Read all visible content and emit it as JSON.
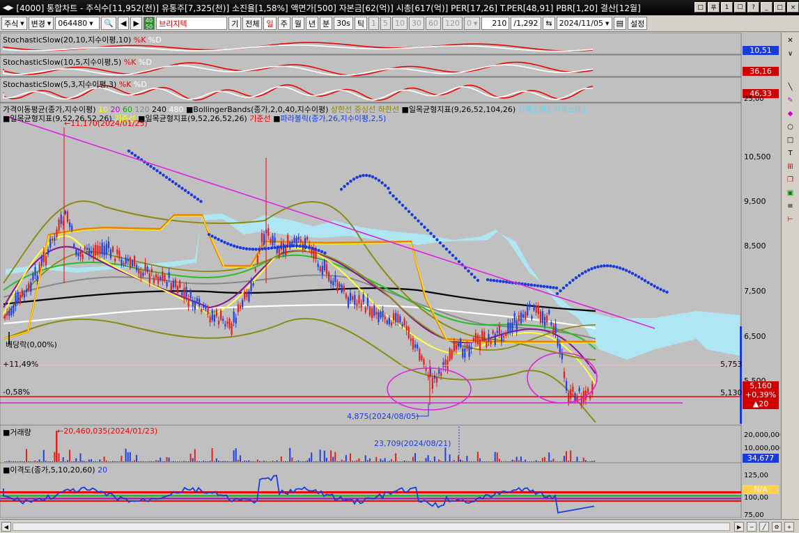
{
  "window": {
    "title": "[4000] 통합차트 - 주식수[11,952(천)] 유통주[7,325(천)] 소진율[1,58%] 액면가[500] 자본금[62(억)] 시총[617(억)] PER[17,26] T.PER[48,91] PBR[1,20] 결산[12월]",
    "nav_glyph": "◀▶",
    "buttons": [
      "□",
      "푸",
      "1",
      "☐",
      "?",
      "_",
      "□",
      "×"
    ]
  },
  "toolbar": {
    "market": "주식",
    "mode": "변경",
    "code": "064480",
    "stock_name": "브리지텍",
    "period_buttons": [
      "기",
      "전체",
      "일",
      "주",
      "월",
      "년",
      "분",
      "30s",
      "틱"
    ],
    "minute_buttons": [
      "1",
      "5",
      "10",
      "30",
      "60",
      "120"
    ],
    "zero_value": "0",
    "count": "210",
    "total": "/1,292",
    "date": "2024/11/05",
    "settings": "설정",
    "selected_period": "일"
  },
  "panels": {
    "stoch1": {
      "name": "StochasticSlow(20,10,지수이평,10)",
      "k": "%K",
      "d": "%D",
      "value": "10,51"
    },
    "stoch2": {
      "name": "StochasticSlow(10,5,지수이평,5)",
      "k": "%K",
      "d": "%D",
      "value": "36,16"
    },
    "stoch3": {
      "name": "StochasticSlow(5,3,지수이평,3)",
      "k": "%K",
      "d": "%D",
      "value": "46,33"
    },
    "stoch3_scale": "25,00",
    "price_legend": {
      "ma": "가격이동평균(종가,지수이평)",
      "ma_periods": [
        "10",
        "20",
        "60",
        "120",
        "240",
        "480"
      ],
      "bb": "BollingerBands(종가,2,0,40,지수이평)",
      "bb_lines": "상한선 중심선 하한선",
      "ichimoku1": "일목균형지표(9,26,52,104,26)",
      "ichimoku1_lines": "선행스팬1 선행스팬2",
      "ichimoku2": "일목균형지표(9,52,26,52,26)",
      "ichimoku2_line": "기준선",
      "ichimoku3": "일목균형지표(9,52,26,52,26)",
      "ichimoku3_line": "기준선",
      "sar": "파라볼릭(종가,26,지수이평,2,5)"
    },
    "volume": {
      "name": "거래량",
      "max_label": "20,460,035(2024/01/23)",
      "recent_label": "23,709(2024/08/21)",
      "value": "34,677",
      "scale_top": "20,000,000",
      "scale_mid": "10,000,000"
    },
    "disparity": {
      "name": "이격도(종가,5,10,20,60)",
      "period": "20",
      "value": "N/A",
      "scale_top": "125,00",
      "scale_mid": "100,00",
      "scale_bottom": "75,00"
    }
  },
  "price_chart": {
    "high_label": "11,170(2024/01/25)",
    "low_label": "4,875(2024/08/05)",
    "dividend": "배당락(0,00%)",
    "pct_up": "+11,49%",
    "pct_down": "-0,58%",
    "level_upper": "5,753",
    "level_lower": "5,130",
    "current_price": "5,160",
    "current_change_pct": "+0,39%",
    "current_change": "▲20",
    "axis_labels": [
      "10,500",
      "9,500",
      "8,500",
      "7,500",
      "6,500",
      "5,500"
    ]
  },
  "colors": {
    "up": "#e02020",
    "down": "#2040e0",
    "cloud": "#aee8f5",
    "trend": "#e020e0",
    "sar": "#1a3adc"
  }
}
